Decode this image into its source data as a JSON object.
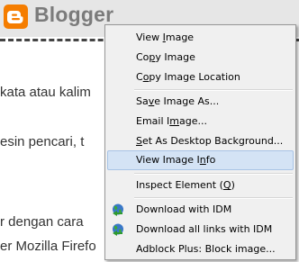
{
  "brand": {
    "name": "Blogger"
  },
  "page": {
    "line1": "kata atau kalim",
    "line2": "esin pencari, t",
    "line3": "r dengan cara",
    "line4": "er Mozilla Firefo"
  },
  "context_menu": {
    "view_image": {
      "pre": "View ",
      "acc": "I",
      "post": "mage"
    },
    "copy_image": {
      "pre": "Co",
      "acc": "p",
      "post": "y Image"
    },
    "copy_image_location": {
      "pre": "C",
      "acc": "o",
      "post": "py Image Location"
    },
    "save_image": {
      "pre": "Sa",
      "acc": "v",
      "post": "e Image As..."
    },
    "email_image": {
      "pre": "Email I",
      "acc": "m",
      "post": "age..."
    },
    "set_background": {
      "pre": "",
      "acc": "S",
      "post": "et As Desktop Background..."
    },
    "view_image_info": {
      "pre": "View Image I",
      "acc": "n",
      "post": "fo"
    },
    "inspect_element": {
      "pre": "Inspect Element (",
      "acc": "Q",
      "post": ")"
    },
    "download_idm": "Download with IDM",
    "download_all_idm": "Download all links with IDM",
    "adblock": "Adblock Plus: Block image..."
  },
  "colors": {
    "blogger_orange": "#f57d00",
    "menu_bg": "#f0f0f0",
    "menu_highlight": "#d4e3f5"
  },
  "icons": [
    "blogger-logo-icon",
    "idm-globe-icon"
  ]
}
